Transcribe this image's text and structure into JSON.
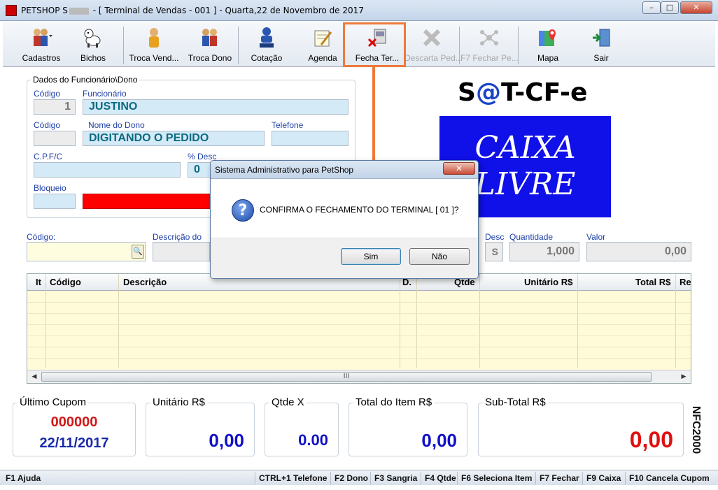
{
  "window": {
    "title_prefix": "PETSHOP S",
    "title_suffix": "- [ Terminal de Vendas  - 001 ] - Quarta,22 de Novembro de 2017",
    "minimize": "–",
    "maximize": "□",
    "close": "✕"
  },
  "toolbar": {
    "items": [
      {
        "label": "Cadastros",
        "icon": "people-menu-icon"
      },
      {
        "label": "Bichos",
        "icon": "dog-icon"
      },
      {
        "label": "Troca Vend...",
        "icon": "person-icon"
      },
      {
        "label": "Troca Dono",
        "icon": "group-icon"
      },
      {
        "label": "Cotação",
        "icon": "user-stack-icon"
      },
      {
        "label": "Agenda",
        "icon": "calendar-pen-icon"
      },
      {
        "label": "Fecha Ter...",
        "icon": "close-terminal-icon"
      },
      {
        "label": "Descarta Ped...",
        "icon": "discard-icon"
      },
      {
        "label": "F7 Fechar Pe...",
        "icon": "network-icon"
      },
      {
        "label": "Mapa",
        "icon": "map-icon"
      },
      {
        "label": "Sair",
        "icon": "exit-icon"
      }
    ]
  },
  "form": {
    "group_title": "Dados do Funcionário\\Dono",
    "codigo_label": "Código",
    "codigo_value": "1",
    "funcionario_label": "Funcionário",
    "funcionario_value": "JUSTINO",
    "codigo2_label": "Código",
    "nome_dono_label": "Nome do Dono",
    "nome_dono_value": "DIGITANDO O PEDIDO",
    "telefone_label": "Telefone",
    "cpf_label": "C.P.F/C",
    "desc_label": "% Desc",
    "desc_value": "0",
    "bloqueio_label": "Bloqueio"
  },
  "entry": {
    "codigo_label": "Código:",
    "descricao_label": "Descrição do",
    "desc_label": "Desc",
    "desc_value": "S",
    "quantidade_label": "Quantidade",
    "quantidade_value": "1,000",
    "valor_label": "Valor",
    "valor_value": "0,00"
  },
  "brand": {
    "sat_part1": "S",
    "sat_at": "@",
    "sat_part2": "T-CF-e",
    "caixa_line1": "CAIXA",
    "caixa_line2": "LIVRE"
  },
  "grid": {
    "columns": [
      "It",
      "Código",
      "Descrição",
      "D.",
      "Qtde",
      "Unitário R$",
      "Total R$",
      "Re"
    ],
    "scroll_thumb": "III"
  },
  "summary": {
    "ultimo_cupom_label": "Último Cupom",
    "ultimo_cupom_number": "000000",
    "ultimo_cupom_date": "22/11/2017",
    "unitario_label": "Unitário R$",
    "unitario_value": "0,00",
    "qtde_label": "Qtde X",
    "qtde_value": "0.00",
    "total_item_label": "Total do Item R$",
    "total_item_value": "0,00",
    "subtotal_label": "Sub-Total R$",
    "subtotal_value": "0,00",
    "badge": "NFC2000"
  },
  "statusbar": {
    "items": [
      "F1 Ajuda",
      "CTRL+1 Telefone",
      "F2 Dono",
      "F3 Sangria",
      "F4 Qtde",
      "F6 Seleciona Item",
      "F7 Fechar",
      "F9 Caixa",
      "F10 Cancela Cupom"
    ]
  },
  "dialog": {
    "title": "Sistema Administrativo para PetShop",
    "close": "✕",
    "message": "CONFIRMA O FECHAMENTO DO TERMINAL [ 01 ]?",
    "icon": "?",
    "yes": "Sim",
    "no": "Não"
  },
  "colors": {
    "accent_highlight": "#ee7a3a",
    "caixa_bg": "#1010e8",
    "subtotal": "#e01010",
    "cupom_number": "#d01818",
    "value_blue": "#1010c8"
  }
}
